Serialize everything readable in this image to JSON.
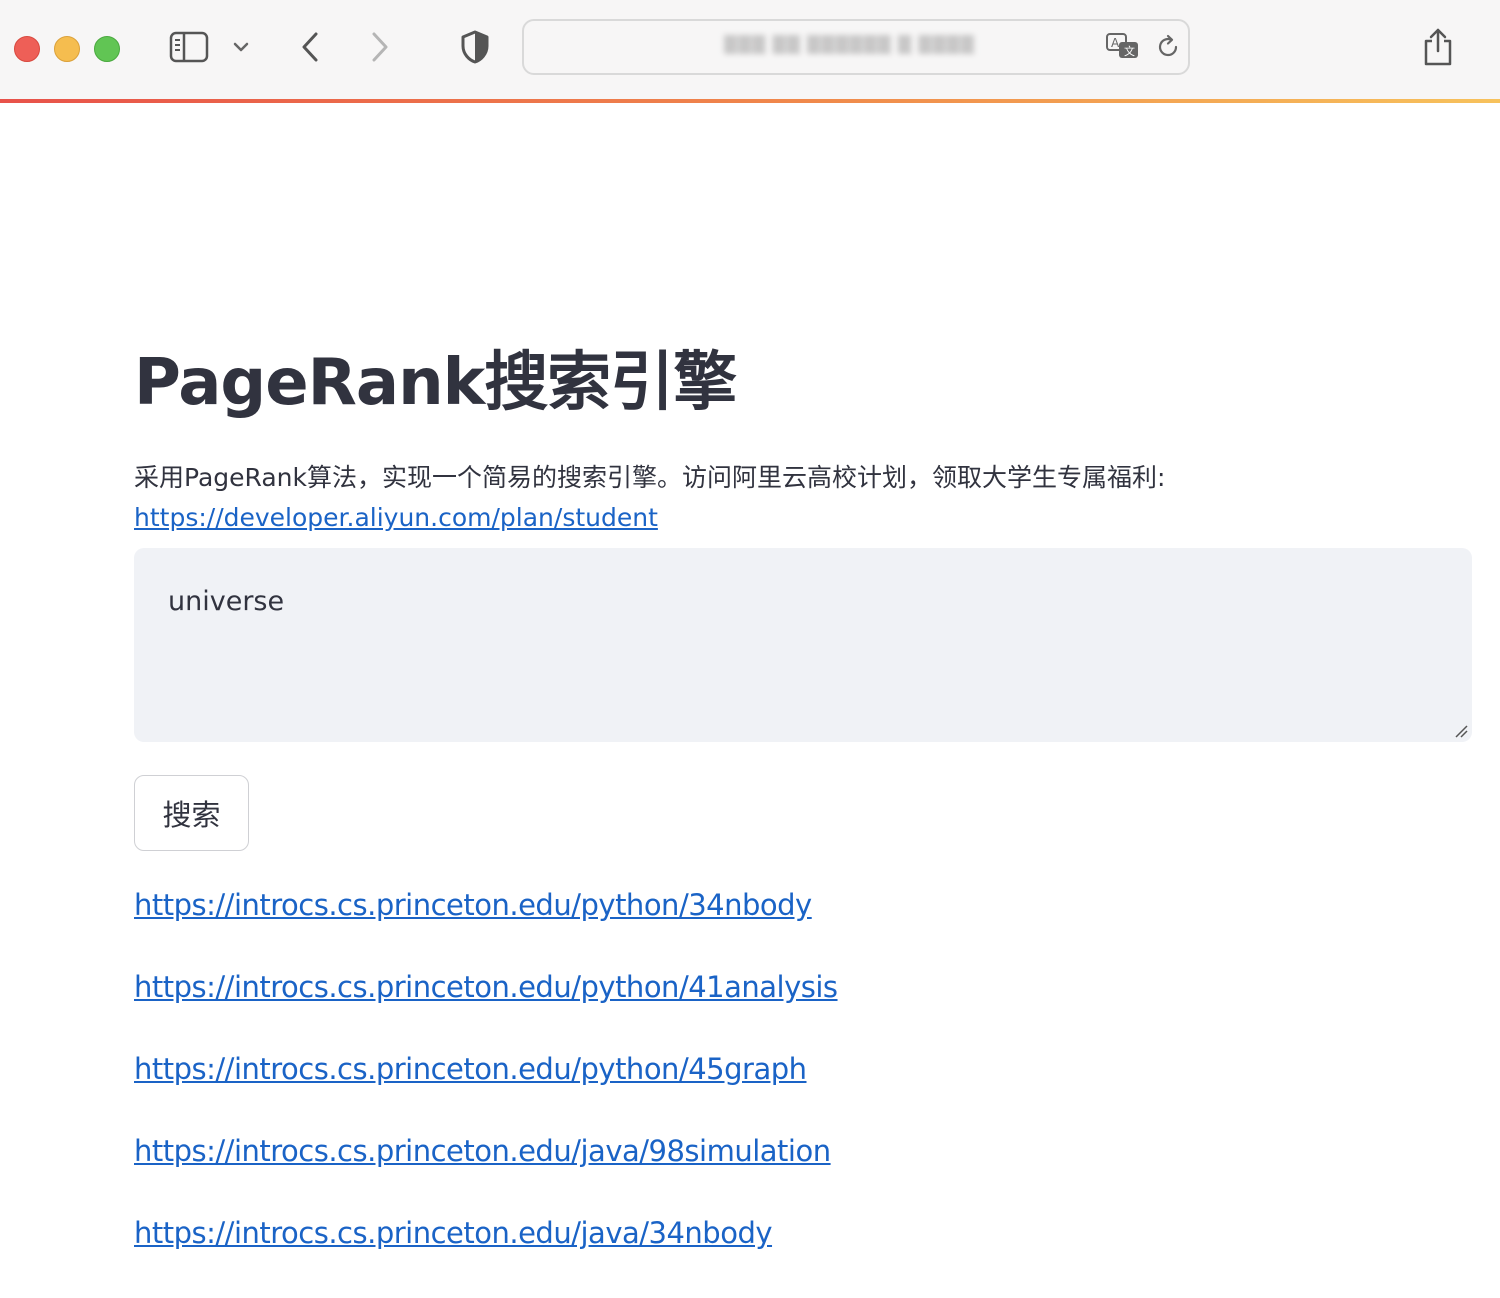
{
  "browser": {
    "address": "▒▒▒ ▒▒ ▒▒▒▒▒▒ ▒ ▒▒▒▒",
    "icons": {
      "close": "close-dot",
      "minimize": "minimize-dot",
      "maximize": "maximize-dot",
      "sidebar": "sidebar-icon",
      "sidebar_menu": "chevron-down-icon",
      "back": "back-arrow-icon",
      "forward": "forward-arrow-icon",
      "privacy": "shield-icon",
      "translate": "translate-icon",
      "reload": "reload-icon",
      "share": "share-icon"
    },
    "accent_gradient": [
      "#e8524a",
      "#f08a4b",
      "#f7c25c"
    ]
  },
  "page": {
    "title": "PageRank搜索引擎",
    "description": "采用PageRank算法，实现一个简易的搜索引擎。访问阿里云高校计划，领取大学生专属福利:",
    "link": "https://developer.aliyun.com/plan/student",
    "query": "universe",
    "search_label": "搜索",
    "results": [
      "https://introcs.cs.princeton.edu/python/34nbody",
      "https://introcs.cs.princeton.edu/python/41analysis",
      "https://introcs.cs.princeton.edu/python/45graph",
      "https://introcs.cs.princeton.edu/java/98simulation",
      "https://introcs.cs.princeton.edu/java/34nbody"
    ]
  },
  "colors": {
    "text": "#31333f",
    "link": "#1a63c6",
    "input_bg": "#f0f2f6"
  }
}
